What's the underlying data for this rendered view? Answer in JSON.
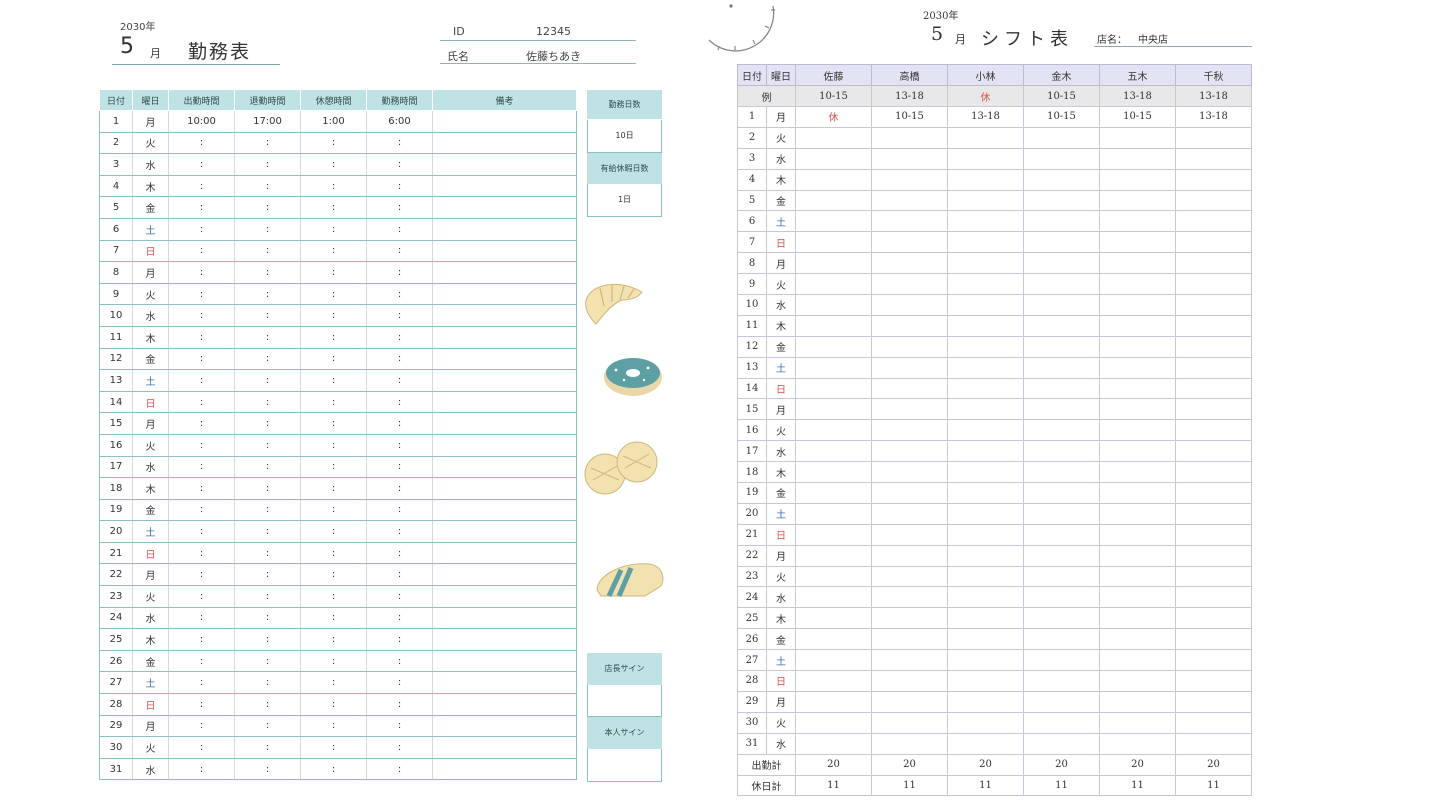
{
  "attendance": {
    "year": "2030年",
    "month": "5",
    "month_unit": "月",
    "title": "勤務表",
    "id_label": "ID",
    "id_value": "12345",
    "name_label": "氏名",
    "name_value": "佐藤ちあき",
    "columns": [
      "日付",
      "曜日",
      "出勤時間",
      "退勤時間",
      "休憩時間",
      "勤務時間",
      "備考"
    ],
    "first_row": {
      "start": "10:00",
      "end": "17:00",
      "break": "1:00",
      "work": "6:00"
    },
    "placeholder": ":",
    "summary": {
      "work_days_label": "勤務日数",
      "work_days_value": "10日",
      "paid_leave_label": "有給休暇日数",
      "paid_leave_value": "1日",
      "manager_sign_label": "店長サイン",
      "self_sign_label": "本人サイン"
    }
  },
  "days": [
    {
      "d": "1",
      "w": "月"
    },
    {
      "d": "2",
      "w": "火"
    },
    {
      "d": "3",
      "w": "水"
    },
    {
      "d": "4",
      "w": "木"
    },
    {
      "d": "5",
      "w": "金"
    },
    {
      "d": "6",
      "w": "土"
    },
    {
      "d": "7",
      "w": "日"
    },
    {
      "d": "8",
      "w": "月"
    },
    {
      "d": "9",
      "w": "火"
    },
    {
      "d": "10",
      "w": "水"
    },
    {
      "d": "11",
      "w": "木"
    },
    {
      "d": "12",
      "w": "金"
    },
    {
      "d": "13",
      "w": "土"
    },
    {
      "d": "14",
      "w": "日"
    },
    {
      "d": "15",
      "w": "月"
    },
    {
      "d": "16",
      "w": "火"
    },
    {
      "d": "17",
      "w": "水"
    },
    {
      "d": "18",
      "w": "木"
    },
    {
      "d": "19",
      "w": "金"
    },
    {
      "d": "20",
      "w": "土"
    },
    {
      "d": "21",
      "w": "日"
    },
    {
      "d": "22",
      "w": "月"
    },
    {
      "d": "23",
      "w": "火"
    },
    {
      "d": "24",
      "w": "水"
    },
    {
      "d": "25",
      "w": "木"
    },
    {
      "d": "26",
      "w": "金"
    },
    {
      "d": "27",
      "w": "土"
    },
    {
      "d": "28",
      "w": "日"
    },
    {
      "d": "29",
      "w": "月"
    },
    {
      "d": "30",
      "w": "火"
    },
    {
      "d": "31",
      "w": "水"
    }
  ],
  "shift": {
    "year": "2030年",
    "month": "5",
    "month_unit": "月",
    "title": "シフト表",
    "store_label": "店名：",
    "store_value": "中央店",
    "date_header": "日付",
    "weekday_header": "曜日",
    "staff": [
      "佐藤",
      "高橋",
      "小林",
      "金木",
      "五木",
      "千秋"
    ],
    "example_label": "例",
    "example": [
      "10-15",
      "13-18",
      "休",
      "10-15",
      "13-18",
      "13-18"
    ],
    "day1": [
      "休",
      "10-15",
      "13-18",
      "10-15",
      "10-15",
      "13-18"
    ],
    "total_work_label": "出勤計",
    "total_work": [
      "20",
      "20",
      "20",
      "20",
      "20",
      "20"
    ],
    "total_off_label": "休日計",
    "total_off": [
      "11",
      "11",
      "11",
      "11",
      "11",
      "11"
    ]
  },
  "colors": {
    "teal_header": "#bfe3e5",
    "lavender_header": "#e2e4f4",
    "sunday_red": "#d9534f",
    "saturday_blue": "#3c6fb4"
  }
}
